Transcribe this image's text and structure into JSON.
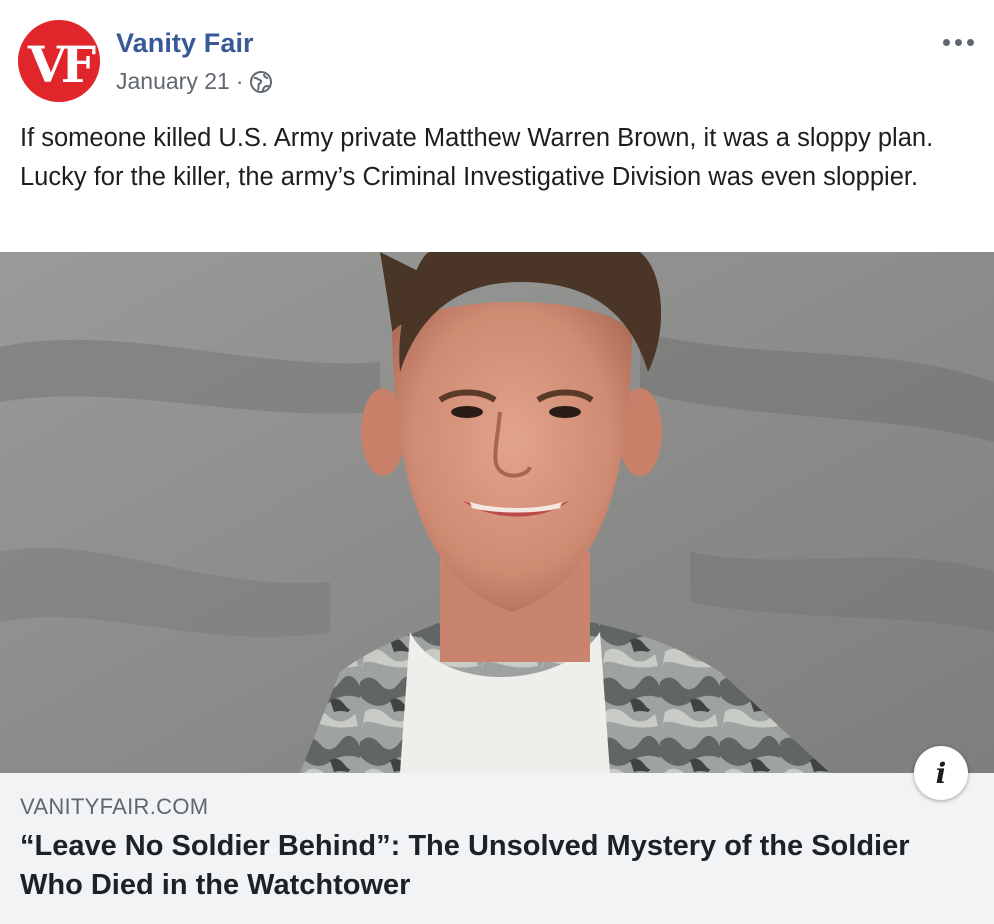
{
  "post": {
    "page_name": "Vanity Fair",
    "avatar_text": "VF",
    "date": "January 21",
    "separator": "·",
    "audience_icon": "globe-icon",
    "more_icon": "more-options-icon",
    "text": "If someone killed U.S. Army private Matthew Warren Brown, it was a sloppy plan. Lucky for the killer, the army’s Criminal Investigative Division was even sloppier."
  },
  "link_preview": {
    "image_alt": "photo",
    "info_label": "i",
    "domain": "VANITYFAIR.COM",
    "title": "“Leave No Soldier Behind”: The Unsolved Mystery of the Soldier Who Died in the Watchtower"
  },
  "colors": {
    "page_name": "#385898",
    "meta_text": "#606770",
    "avatar_bg": "#e0262a",
    "link_box_bg": "#f2f3f5"
  }
}
